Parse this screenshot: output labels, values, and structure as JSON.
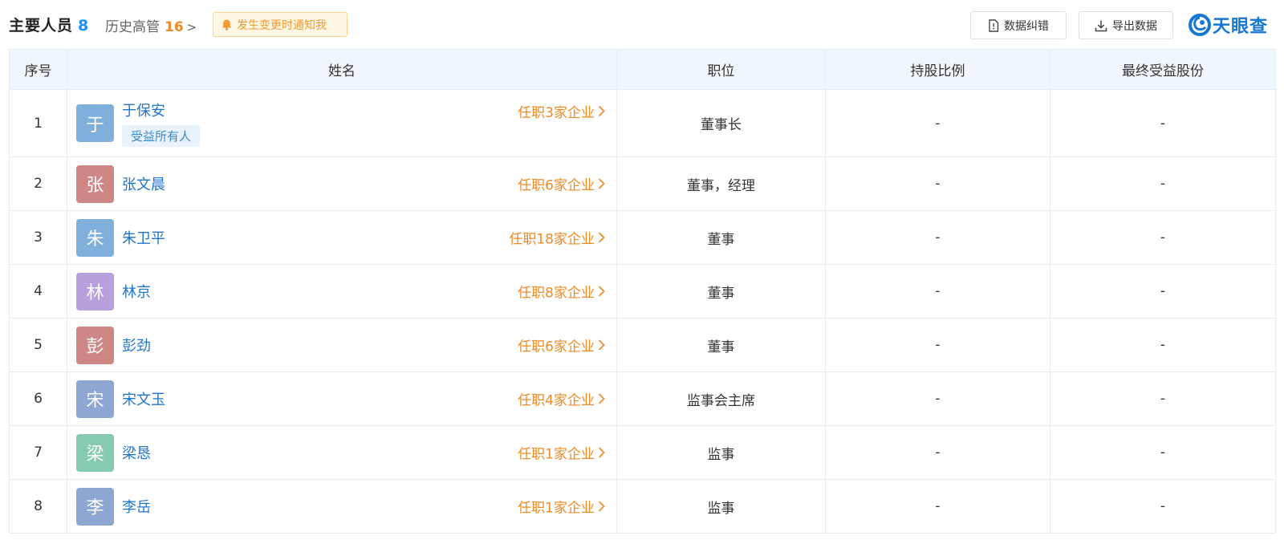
{
  "header": {
    "main_title": "主要人员",
    "main_count": "8",
    "history_title": "历史高管",
    "history_count": "16",
    "history_chevron": ">",
    "notify_label": "发生变更时通知我",
    "correct_label": "数据纠错",
    "export_label": "导出数据",
    "logo_text": "天眼查"
  },
  "table": {
    "columns": [
      "序号",
      "姓名",
      "职位",
      "持股比例",
      "最终受益股份"
    ],
    "rows": [
      {
        "index": "1",
        "avatar": "于",
        "avatar_color": "#7fb0db",
        "name": "于保安",
        "tag": "受益所有人",
        "positions": "任职3家企业",
        "title": "董事长",
        "share": "-",
        "benefit": "-"
      },
      {
        "index": "2",
        "avatar": "张",
        "avatar_color": "#cf8785",
        "name": "张文晨",
        "tag": "",
        "positions": "任职6家企业",
        "title": "董事，经理",
        "share": "-",
        "benefit": "-"
      },
      {
        "index": "3",
        "avatar": "朱",
        "avatar_color": "#7fb0db",
        "name": "朱卫平",
        "tag": "",
        "positions": "任职18家企业",
        "title": "董事",
        "share": "-",
        "benefit": "-"
      },
      {
        "index": "4",
        "avatar": "林",
        "avatar_color": "#b8a0dc",
        "name": "林京",
        "tag": "",
        "positions": "任职8家企业",
        "title": "董事",
        "share": "-",
        "benefit": "-"
      },
      {
        "index": "5",
        "avatar": "彭",
        "avatar_color": "#cf8785",
        "name": "彭劲",
        "tag": "",
        "positions": "任职6家企业",
        "title": "董事",
        "share": "-",
        "benefit": "-"
      },
      {
        "index": "6",
        "avatar": "宋",
        "avatar_color": "#8ea6d2",
        "name": "宋文玉",
        "tag": "",
        "positions": "任职4家企业",
        "title": "监事会主席",
        "share": "-",
        "benefit": "-"
      },
      {
        "index": "7",
        "avatar": "梁",
        "avatar_color": "#86cbb0",
        "name": "梁恳",
        "tag": "",
        "positions": "任职1家企业",
        "title": "监事",
        "share": "-",
        "benefit": "-"
      },
      {
        "index": "8",
        "avatar": "李",
        "avatar_color": "#8ea6d2",
        "name": "李岳",
        "tag": "",
        "positions": "任职1家企业",
        "title": "监事",
        "share": "-",
        "benefit": "-"
      }
    ]
  },
  "colors": {
    "accent_blue": "#1890ff",
    "orange": "#f08a24",
    "header_bg": "#f0f6fd"
  }
}
